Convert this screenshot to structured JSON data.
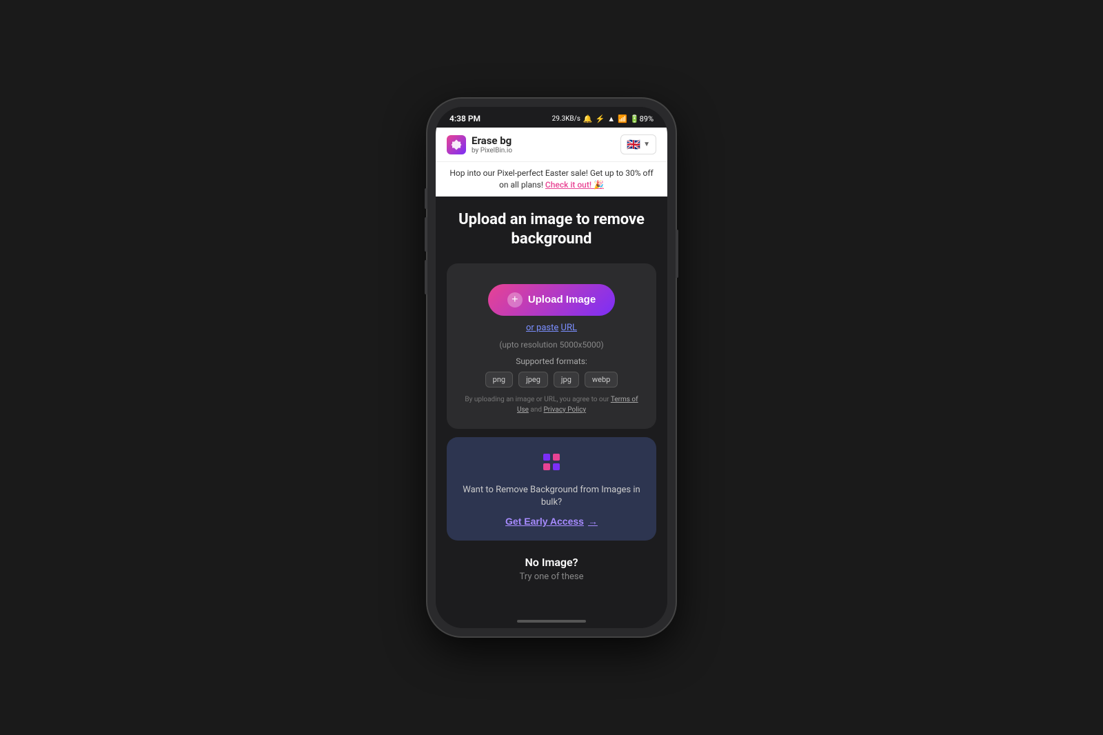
{
  "phone": {
    "status_bar": {
      "time": "4:38 PM",
      "data_speed": "29.3KB/s",
      "battery": "89%",
      "signal": "●"
    }
  },
  "header": {
    "app_name": "Erase bg",
    "by_text": "by PixelBin.io",
    "lang_label": "EN"
  },
  "promo_banner": {
    "text": "Hop into our Pixel-perfect Easter sale! Get up to 30% off on all plans!",
    "link_text": "Check it out! 🎉"
  },
  "main": {
    "page_title": "Upload an image to remove background",
    "upload_button_label": "Upload Image",
    "paste_label": "or paste",
    "url_label": "URL",
    "resolution_text": "(upto resolution 5000x5000)",
    "formats_label": "Supported formats:",
    "formats": [
      "png",
      "jpeg",
      "jpg",
      "webp"
    ],
    "terms_prefix": "By uploading an image or URL, you agree to our",
    "terms_link": "Terms of Use",
    "and_text": "and",
    "privacy_link": "Privacy Policy",
    "bulk_text": "Want to Remove Background from Images in bulk?",
    "early_access_label": "Get Early Access",
    "no_image_title": "No Image?",
    "try_text": "Try one of these"
  }
}
